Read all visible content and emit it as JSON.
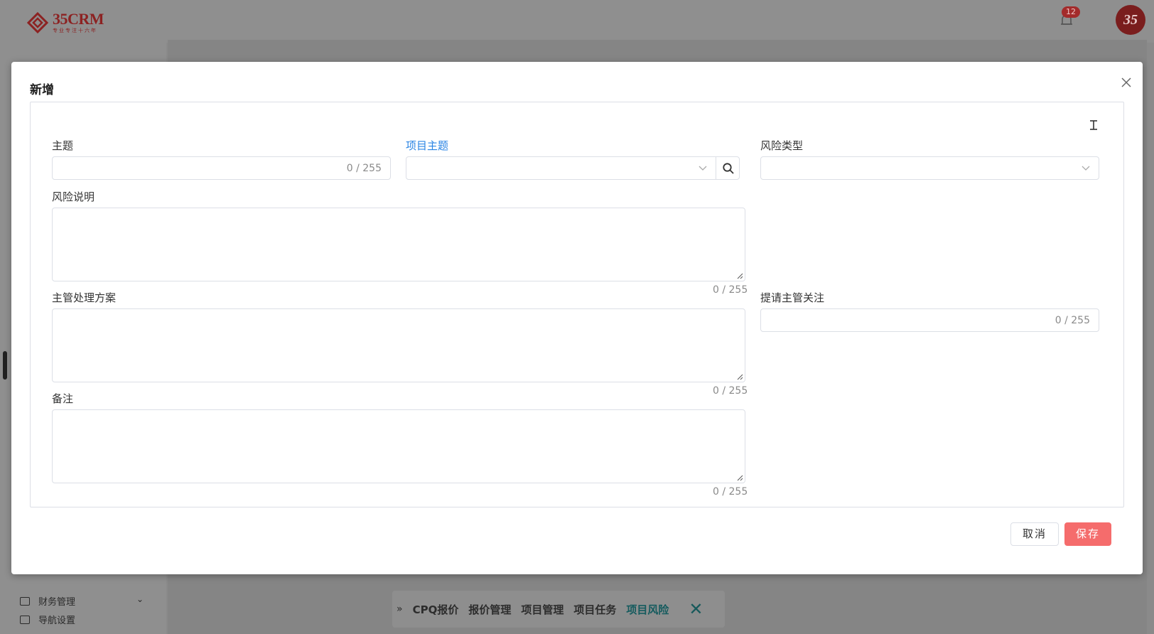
{
  "app": {
    "logo_text": "35CRM",
    "logo_subtitle": "专业专注十六年",
    "notification_count": "12",
    "avatar_text": "35"
  },
  "sidebar": {
    "items": [
      {
        "label": "财务管理",
        "icon": "finance-icon",
        "expandable": true
      },
      {
        "label": "导航设置",
        "icon": "navigation-icon",
        "expandable": false
      }
    ]
  },
  "bottom_tabs": {
    "tabs": [
      "CPQ报价",
      "报价管理",
      "项目管理",
      "项目任务",
      "项目风险"
    ],
    "active": "项目风险"
  },
  "modal": {
    "title": "新增",
    "fields": {
      "subject": {
        "label": "主题",
        "value": "",
        "counter": "0 / 255"
      },
      "project_subject": {
        "label": "项目主题",
        "value": ""
      },
      "risk_type": {
        "label": "风险类型",
        "value": ""
      },
      "risk_description": {
        "label": "风险说明",
        "value": "",
        "counter": "0 / 255"
      },
      "supervisor_plan": {
        "label": "主管处理方案",
        "value": "",
        "counter": "0 / 255"
      },
      "request_supervisor_attention": {
        "label": "提请主管关注",
        "value": "",
        "counter": "0 / 255"
      },
      "remarks": {
        "label": "备注",
        "value": "",
        "counter": "0 / 255"
      }
    },
    "buttons": {
      "cancel": "取消",
      "save": "保存"
    }
  },
  "colors": {
    "primary_link": "#2b85e4",
    "save_button": "#f56c6c",
    "brand": "#8c2222"
  }
}
